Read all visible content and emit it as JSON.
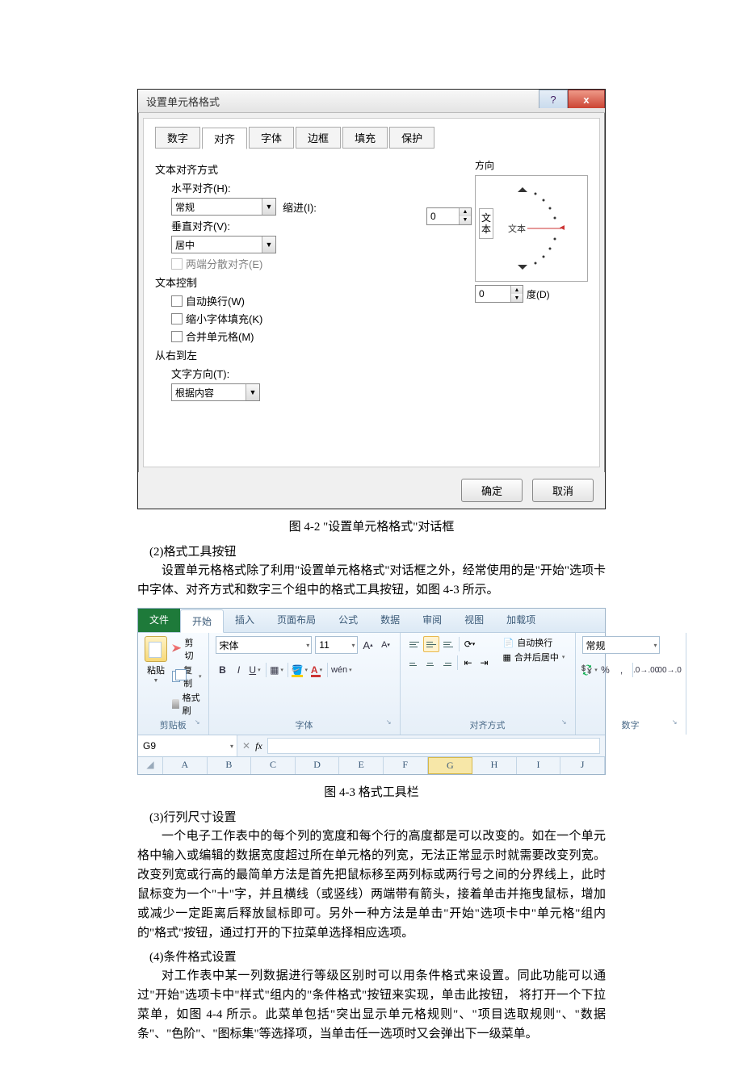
{
  "dialog": {
    "title": "设置单元格格式",
    "tabs": [
      "数字",
      "对齐",
      "字体",
      "边框",
      "填充",
      "保护"
    ],
    "active_tab": 1,
    "text_align_group": "文本对齐方式",
    "h_label": "水平对齐(H):",
    "h_value": "常规",
    "indent_label": "缩进(I):",
    "indent_value": "0",
    "v_label": "垂直对齐(V):",
    "v_value": "居中",
    "justify_dist": "两端分散对齐(E)",
    "text_ctrl_group": "文本控制",
    "wrap": "自动换行(W)",
    "shrink": "缩小字体填充(K)",
    "merge": "合并单元格(M)",
    "rtl_group": "从右到左",
    "dir_label": "文字方向(T):",
    "dir_value": "根据内容",
    "orient_group": "方向",
    "orient_vert": "文\n本",
    "orient_text": "文本",
    "deg_value": "0",
    "deg_label": "度(D)",
    "ok": "确定",
    "cancel": "取消"
  },
  "caption1": "图 4-2 \"设置单元格格式\"对话框",
  "sec2_head": "(2)格式工具按钮",
  "sec2_p": "设置单元格格式除了利用\"设置单元格格式\"对话框之外，经常使用的是\"开始\"选项卡中字体、对齐方式和数字三个组中的格式工具按钮，如图 4-3 所示。",
  "ribbon": {
    "tabs": {
      "file": "文件",
      "home": "开始",
      "insert": "插入",
      "layout": "页面布局",
      "formula": "公式",
      "data": "数据",
      "review": "审阅",
      "view": "视图",
      "addin": "加载项"
    },
    "clipboard": {
      "paste": "粘贴",
      "cut": "剪切",
      "copy": "复制",
      "painter": "格式刷",
      "label": "剪贴板"
    },
    "font": {
      "name": "宋体",
      "size": "11",
      "label": "字体"
    },
    "align": {
      "wrap": "自动换行",
      "merge": "合并后居中",
      "label": "对齐方式"
    },
    "number": {
      "fmt": "常规",
      "label": "数字"
    },
    "namebox": "G9",
    "cols": [
      "A",
      "B",
      "C",
      "D",
      "E",
      "F",
      "G",
      "H",
      "I",
      "J"
    ]
  },
  "caption2": "图 4-3 格式工具栏",
  "sec3_head": "(3)行列尺寸设置",
  "sec3_p": "一个电子工作表中的每个列的宽度和每个行的高度都是可以改变的。如在一个单元格中输入或编辑的数据宽度超过所在单元格的列宽，无法正常显示时就需要改变列宽。改变列宽或行高的最简单方法是首先把鼠标移至两列标或两行号之间的分界线上，此时鼠标变为一个\"十\"字，并且横线（或竖线）两端带有箭头，接着单击并拖曳鼠标，增加或减少一定距离后释放鼠标即可。另外一种方法是单击\"开始\"选项卡中\"单元格\"组内的\"格式\"按钮，通过打开的下拉菜单选择相应选项。",
  "sec4_head": "(4)条件格式设置",
  "sec4_p": "对工作表中某一列数据进行等级区别时可以用条件格式来设置。同此功能可以通过\"开始\"选项卡中\"样式\"组内的\"条件格式\"按钮来实现，单击此按钮， 将打开一个下拉菜单，如图 4-4 所示。此菜单包括\"突出显示单元格规则\"、\"项目选取规则\"、\"数据条\"、\"色阶\"、\"图标集\"等选择项，当单击任一选项时又会弹出下一级菜单。"
}
